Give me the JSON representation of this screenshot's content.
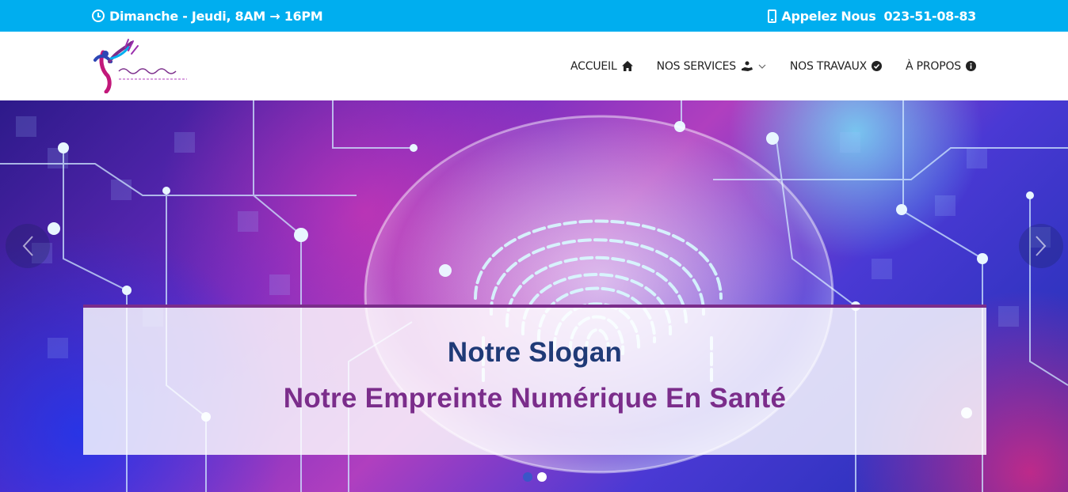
{
  "topbar": {
    "hours": "Dimanche - Jeudi, 8AM  → 16PM",
    "call_label": "Appelez Nous",
    "phone": "023-51-08-83",
    "bg_color": "#00aeef"
  },
  "navbar": {
    "logo_icon": "logo-icon",
    "items": [
      {
        "label": "ACCUEIL",
        "icon": "home-icon"
      },
      {
        "label": "NOS SERVICES",
        "icon": "hand-service-icon"
      },
      {
        "label": "NOS TRAVAUX",
        "icon": "check-circle-icon"
      },
      {
        "label": "À PROPOS",
        "icon": "info-icon"
      }
    ]
  },
  "hero": {
    "slogan": "Notre Slogan",
    "subslogan": "Notre Empreinte Numérique En Santé",
    "slogan_color": "#1f3a77",
    "subslogan_color": "#7b2d8b",
    "active_slide": 1,
    "slide_count": 2
  }
}
